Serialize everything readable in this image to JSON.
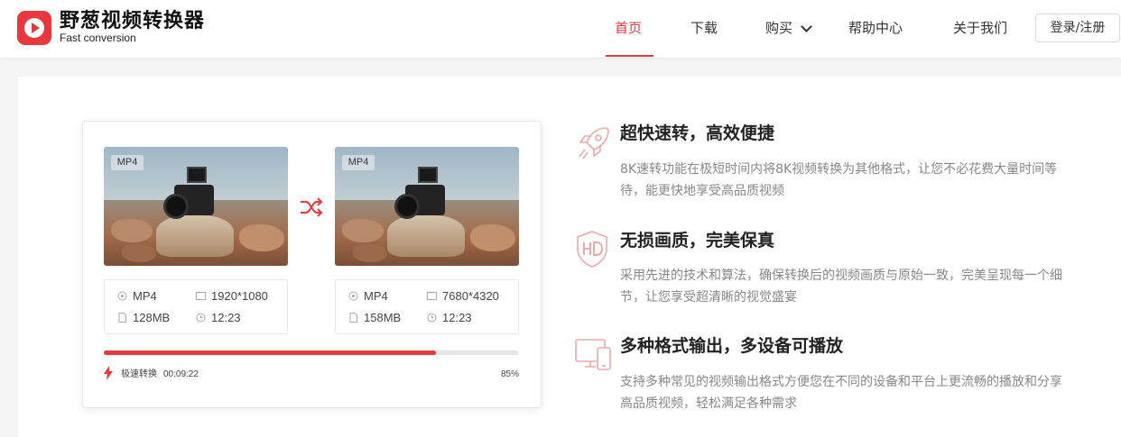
{
  "app": {
    "title": "野葱视频转换器",
    "subtitle": "Fast conversion",
    "brand_color": "#e8383d"
  },
  "nav": {
    "home": "首页",
    "download": "下载",
    "buy": "购买",
    "help": "帮助中心",
    "about": "关于我们",
    "login": "登录/注册"
  },
  "demo": {
    "source": {
      "format_badge": "MP4",
      "format": "MP4",
      "resolution": "1920*1080",
      "size": "128MB",
      "duration": "12:23"
    },
    "target": {
      "format_badge": "MP4",
      "format": "MP4",
      "resolution": "7680*4320",
      "size": "158MB",
      "duration": "12:23"
    },
    "progress": 0.8,
    "speed_label": "极速转换",
    "elapsed": "00:09:22",
    "percent_text": "85%"
  },
  "features": [
    {
      "icon": "rocket-icon",
      "title": "超快速转，高效便捷",
      "desc_line1": "8K速转功能在极短时间内将8K视频转换为其他格式，让您不必花费大量时间等",
      "desc_line2": "待，能更快地享受高品质视频"
    },
    {
      "icon": "hd-shield-icon",
      "title": "无损画质，完美保真",
      "desc_line1": "采用先进的技术和算法，确保转换后的视频画质与原始一致，完美呈现每一个细",
      "desc_line2": "节，让您享受超清晰的视觉盛宴"
    },
    {
      "icon": "devices-icon",
      "title": "多种格式输出，多设备可播放",
      "desc_line1": "支持多种常见的视频输出格式方便您在不同的设备和平台上更流畅的播放和分享",
      "desc_line2": "高品质视频，轻松满足各种需求"
    }
  ]
}
